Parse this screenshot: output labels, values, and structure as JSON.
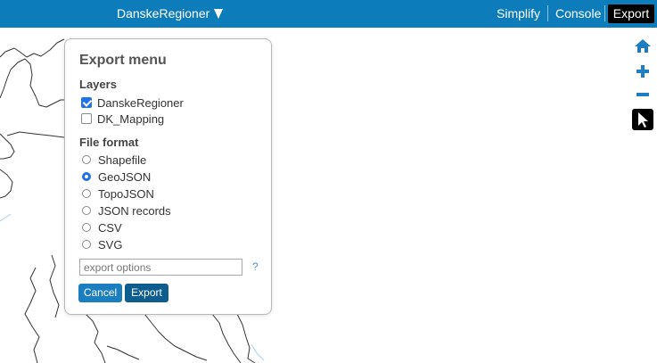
{
  "topbar": {
    "layer_name": "DanskeRegioner",
    "menu": {
      "simplify": "Simplify",
      "console": "Console",
      "export": "Export"
    }
  },
  "tools": [
    "home-icon",
    "zoom-in-icon",
    "zoom-out-icon",
    "pointer-icon"
  ],
  "export_dialog": {
    "title": "Export menu",
    "layers_heading": "Layers",
    "layers": [
      {
        "label": "DanskeRegioner",
        "checked": true
      },
      {
        "label": "DK_Mapping",
        "checked": false
      }
    ],
    "format_heading": "File format",
    "formats": [
      {
        "label": "Shapefile",
        "selected": false
      },
      {
        "label": "GeoJSON",
        "selected": true
      },
      {
        "label": "TopoJSON",
        "selected": false
      },
      {
        "label": "JSON records",
        "selected": false
      },
      {
        "label": "CSV",
        "selected": false
      },
      {
        "label": "SVG",
        "selected": false
      }
    ],
    "options_placeholder": "export options",
    "help": "?",
    "cancel_label": "Cancel",
    "export_label": "Export"
  },
  "colors": {
    "topbar": "#0d7cba",
    "accent": "#1f73e8",
    "cancel": "#1a7ec0",
    "export": "#0d5e8e",
    "map_line": "#333333",
    "water_line": "#a9cfe9"
  }
}
